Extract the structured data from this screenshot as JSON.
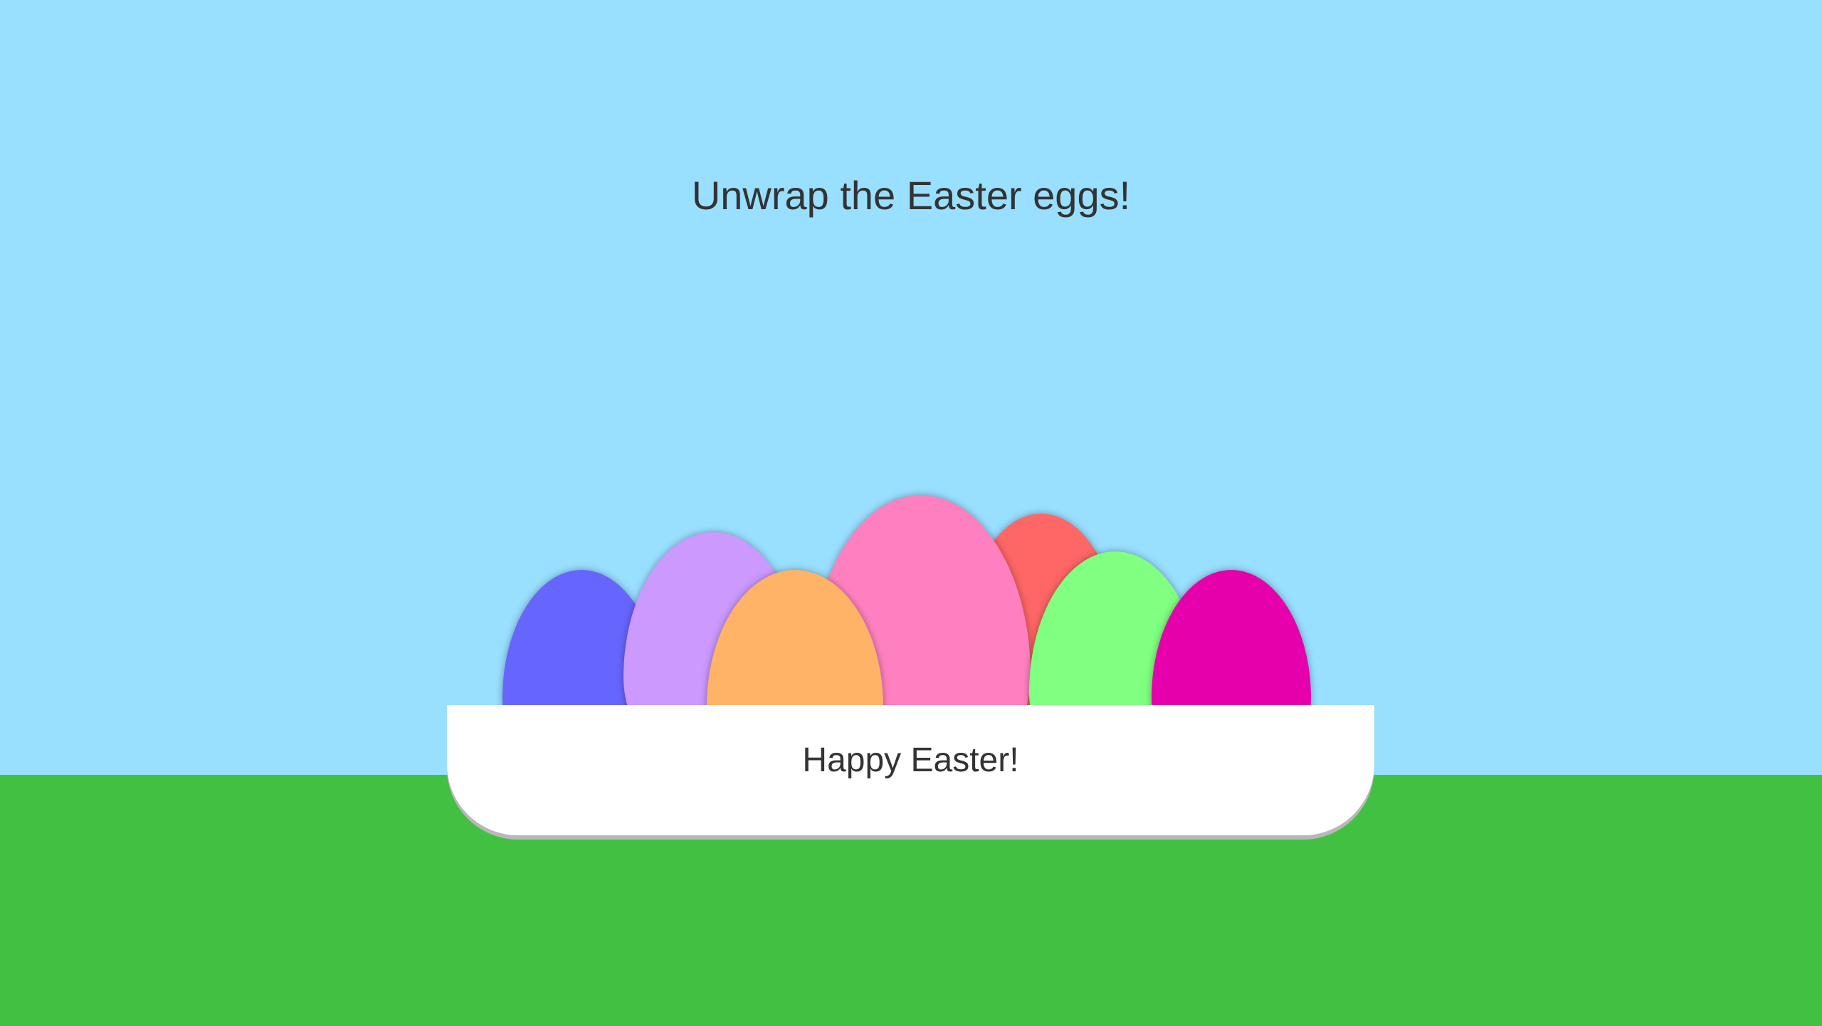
{
  "heading": "Unwrap the Easter eggs!",
  "basket": {
    "message": "Happy Easter!"
  },
  "eggs": [
    {
      "name": "blue",
      "color": "#6666ff"
    },
    {
      "name": "lavender",
      "color": "#cc99ff"
    },
    {
      "name": "orange",
      "color": "#ffb366"
    },
    {
      "name": "pink",
      "color": "#ff80c0"
    },
    {
      "name": "red",
      "color": "#ff6666"
    },
    {
      "name": "green",
      "color": "#80ff80"
    },
    {
      "name": "magenta",
      "color": "#e600ac"
    }
  ],
  "colors": {
    "sky": "#99dfff",
    "grass": "#42c042",
    "basket": "#ffffff",
    "text": "#333333"
  }
}
